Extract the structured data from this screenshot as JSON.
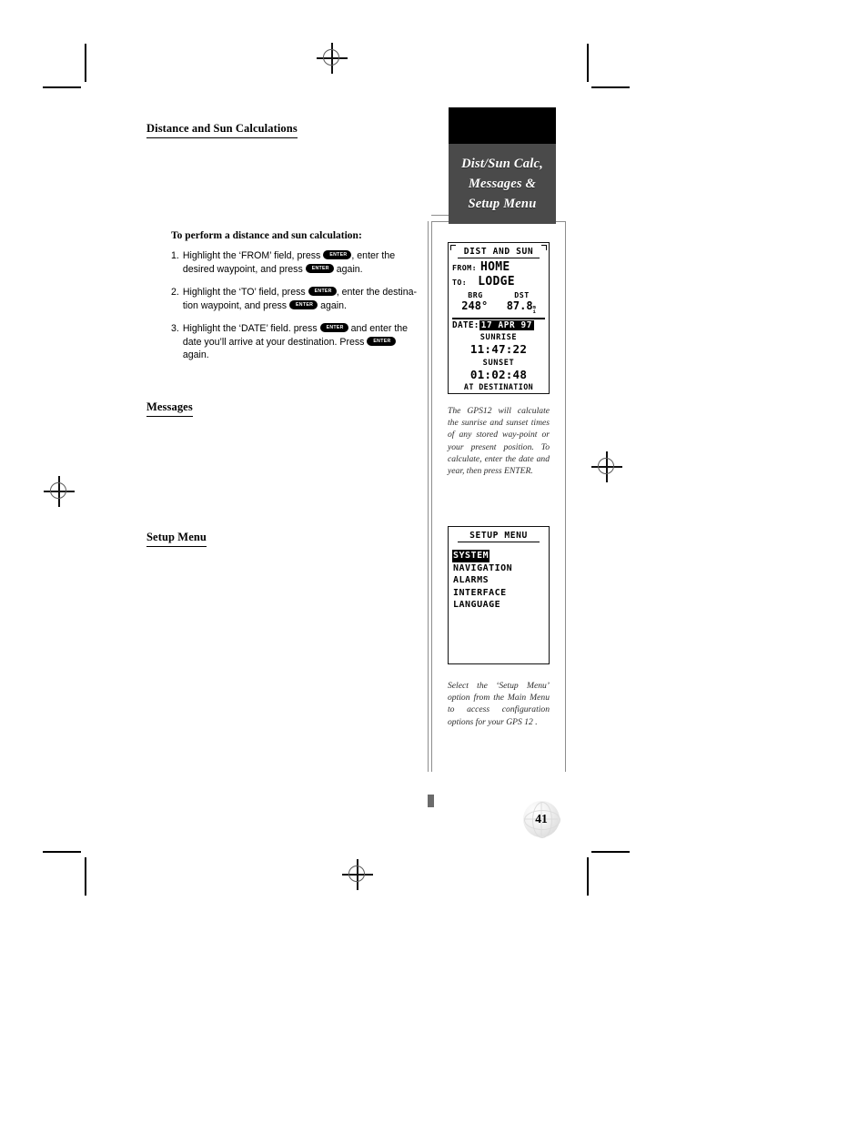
{
  "document": {
    "page_number": "41",
    "section_title": "Distance and Sun Calculations"
  },
  "sidebar_tab": {
    "line1": "Dist/Sun Calc,",
    "line2": "Messages &",
    "line3": "Setup Menu"
  },
  "headings": {
    "distance_and_sun": "Distance and Sun Calculations",
    "messages": "Messages",
    "setup_menu": "Setup Menu"
  },
  "procedure": {
    "lead": "To perform a distance and sun calculation:",
    "steps": [
      {
        "num": "1.",
        "part1": "Highlight the ‘FROM’ field, press",
        "key1": "ENTER",
        "part2": ", enter the desired waypoint, and press",
        "key2": "ENTER",
        "part3": "again."
      },
      {
        "num": "2.",
        "part1": "Highlight the ‘TO’ field, press",
        "key1": "ENTER",
        "part2": ", enter the destina-tion waypoint, and press",
        "key2": "ENTER",
        "part3": "again."
      },
      {
        "num": "3.",
        "part1": "Highlight the ‘DATE’ field. press",
        "key1": "ENTER",
        "part2": "and enter the date you’ll arrive at your destination. Press",
        "key2": "ENTER",
        "part3": "again."
      }
    ]
  },
  "dist_sun_screen": {
    "title": "DIST AND SUN",
    "from_label": "FROM:",
    "from_value": "HOME",
    "to_label": "TO:",
    "to_value": "LODGE",
    "brg_label": "BRG",
    "dst_label": "DST",
    "brg_value": "248°",
    "dst_value": "87.8",
    "dst_unit_top": "m",
    "dst_unit_bottom": "i",
    "date_label": "DATE:",
    "date_value": "17 APR 97",
    "sunrise_label": "SUNRISE",
    "sunrise_value": "11:47:22",
    "sunset_label": "SUNSET",
    "sunset_value": "01:02:48",
    "footer": "AT DESTINATION"
  },
  "setup_menu_screen": {
    "title": "SETUP MENU",
    "items": [
      {
        "label": "SYSTEM",
        "selected": true
      },
      {
        "label": "NAVIGATION",
        "selected": false
      },
      {
        "label": "ALARMS",
        "selected": false
      },
      {
        "label": "INTERFACE",
        "selected": false
      },
      {
        "label": "LANGUAGE",
        "selected": false
      }
    ]
  },
  "captions": {
    "dist_sun": "The GPS12 will calculate the sunrise and sunset times of any stored way-point or your present position. To calculate, enter the date and year, then press ENTER.",
    "setup_menu": "Select the ‘Setup Menu’ option from the Main Menu to access configuration options for your GPS 12 ."
  }
}
